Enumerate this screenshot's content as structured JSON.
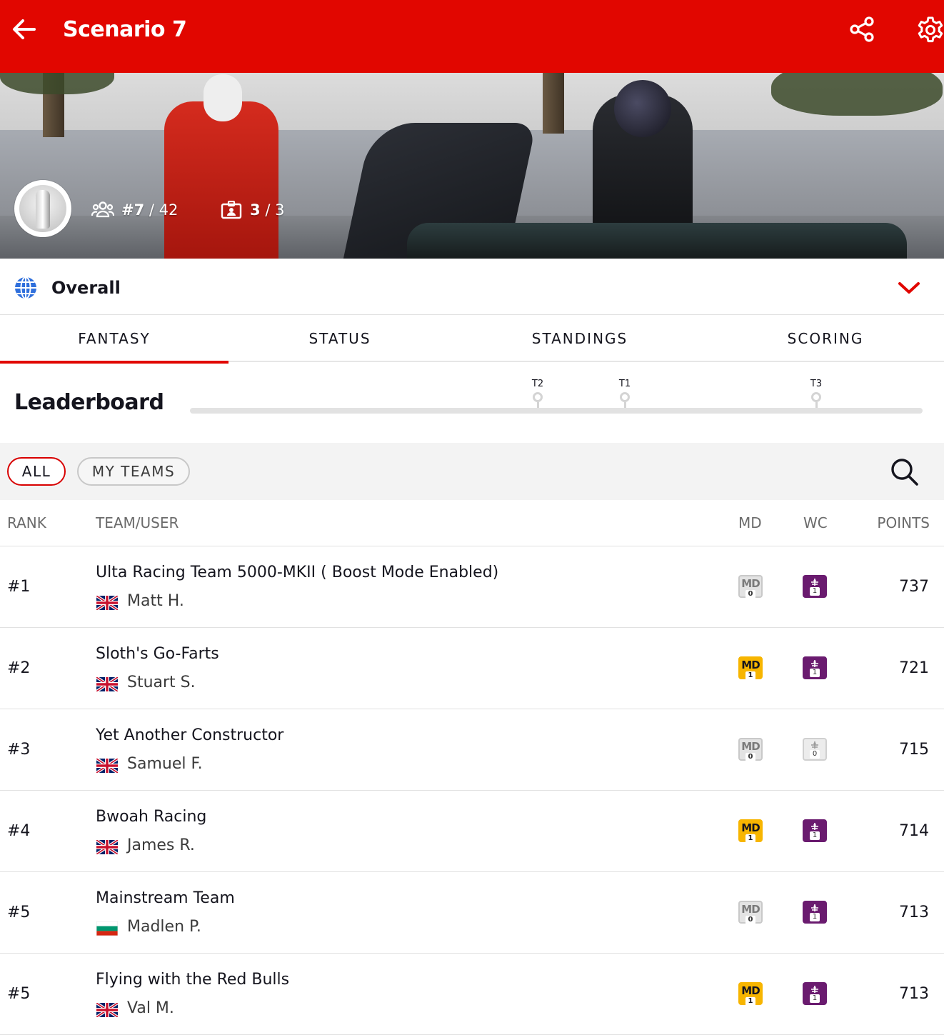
{
  "header": {
    "title": "Scenario 7"
  },
  "hero": {
    "rank_value": "#7",
    "rank_total": "/ 42",
    "teams_value": "3",
    "teams_total": "/ 3"
  },
  "league": {
    "name": "Overall"
  },
  "tabs": [
    {
      "label": "FANTASY",
      "active": true
    },
    {
      "label": "STATUS",
      "active": false
    },
    {
      "label": "STANDINGS",
      "active": false
    },
    {
      "label": "SCORING",
      "active": false
    }
  ],
  "leaderboard": {
    "title": "Leaderboard",
    "markers": [
      "T2",
      "T1",
      "T3"
    ]
  },
  "filters": {
    "all": "ALL",
    "my_teams": "MY TEAMS"
  },
  "table": {
    "headers": {
      "rank": "RANK",
      "team": "TEAM/USER",
      "md": "MD",
      "wc": "WC",
      "points": "POINTS"
    },
    "rows": [
      {
        "rank": "#1",
        "team": "Ulta Racing Team 5000-MKII ( Boost Mode Enabled)",
        "user": "Matt H.",
        "flag": "uk",
        "md_label": "MD",
        "md_count": "0",
        "wc_count": "1",
        "points": "737"
      },
      {
        "rank": "#2",
        "team": "Sloth's Go-Farts",
        "user": "Stuart S.",
        "flag": "uk",
        "md_label": "MD",
        "md_count": "1",
        "wc_count": "1",
        "points": "721"
      },
      {
        "rank": "#3",
        "team": "Yet Another Constructor",
        "user": "Samuel F.",
        "flag": "uk",
        "md_label": "MD",
        "md_count": "0",
        "wc_count": "0",
        "points": "715"
      },
      {
        "rank": "#4",
        "team": "Bwoah Racing",
        "user": "James R.",
        "flag": "uk",
        "md_label": "MD",
        "md_count": "1",
        "wc_count": "1",
        "points": "714"
      },
      {
        "rank": "#5",
        "team": "Mainstream Team",
        "user": "Madlen P.",
        "flag": "bg",
        "md_label": "MD",
        "md_count": "0",
        "wc_count": "1",
        "points": "713"
      },
      {
        "rank": "#5",
        "team": "Flying with the Red Bulls",
        "user": "Val M.",
        "flag": "uk",
        "md_label": "MD",
        "md_count": "1",
        "wc_count": "1",
        "points": "713"
      }
    ]
  },
  "colors": {
    "brand_red": "#e10600",
    "mega_driver_gold": "#f7b500",
    "wildcard_purple": "#6a1b6f"
  },
  "icons": [
    "back-arrow-icon",
    "share-icon",
    "gear-icon",
    "users-icon",
    "id-badge-icon",
    "globe-icon",
    "chevron-down-icon",
    "search-icon",
    "flag-uk-icon",
    "flag-bulgaria-icon",
    "wildcard-icon"
  ]
}
